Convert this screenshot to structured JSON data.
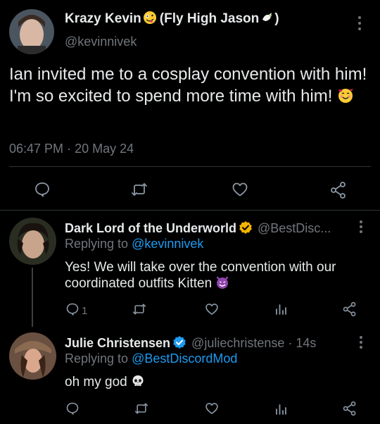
{
  "main_tweet": {
    "display_name": "Krazy Kevin",
    "display_name_suffix": "(Fly High Jason",
    "display_name_close": ")",
    "handle": "@kevinnivek",
    "text": "Ian invited me to a cosplay convention with him! I'm so excited to spend more time with him!",
    "time": "06:47 PM",
    "date": "20 May 24",
    "dot": "·",
    "emojis": [
      "zany-face",
      "dove",
      "smiling-face-with-hearts"
    ]
  },
  "reply1": {
    "display_name": "Dark Lord of the Underworld",
    "handle": "@BestDisc...",
    "replying_prefix": "Replying to",
    "replying_to": "@kevinnivek",
    "text": "Yes! We will take over the convention with our coordinated outfits Kitten",
    "reply_count": "1",
    "emoji": "smiling-imp"
  },
  "reply2": {
    "display_name": "Julie Christensen",
    "handle": "@juliechristense",
    "dot": "·",
    "time": "14s",
    "replying_prefix": "Replying to",
    "replying_to": "@BestDiscordMod",
    "text": "oh my god",
    "emoji": "skull"
  },
  "colors": {
    "background": "#000000",
    "text": "#e7e9ea",
    "muted": "#71767b",
    "link": "#1d9bf0",
    "verified": "#f4b400",
    "divider": "#2f3336"
  }
}
